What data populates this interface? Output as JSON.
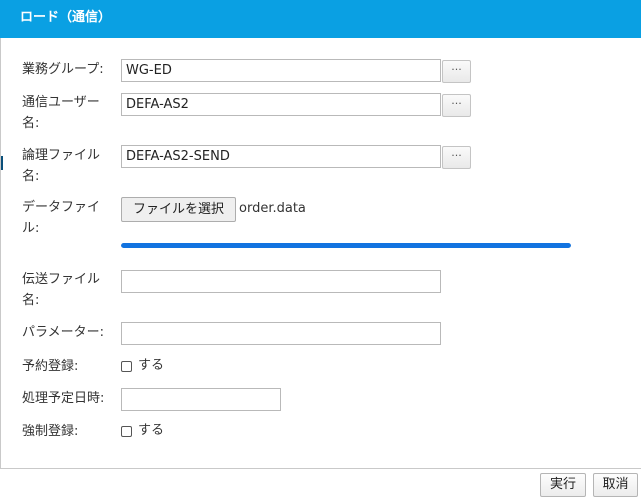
{
  "dialog": {
    "title": "ロード（通信）"
  },
  "form": {
    "business_group": {
      "label": "業務グループ:",
      "value": "WG-ED",
      "browse_label": "···"
    },
    "comm_user": {
      "label_line1": "通信ユーザー",
      "label_line2": "名:",
      "value": "DEFA-AS2",
      "browse_label": "···"
    },
    "logical_file": {
      "label_line1": "論理ファイル",
      "label_line2": "名:",
      "value": "DEFA-AS2-SEND",
      "browse_label": "···"
    },
    "data_file": {
      "label_line1": "データファイ",
      "label_line2": "ル:",
      "choose_label": "ファイルを選択",
      "file_name": "order.data",
      "upload_progress": 1.0
    },
    "transfer_file": {
      "label_line1": "伝送ファイル",
      "label_line2": "名:",
      "value": ""
    },
    "parameter": {
      "label": "パラメーター:",
      "value": ""
    },
    "reservation": {
      "label": "予約登録:",
      "checkbox_label": "する",
      "checked": false
    },
    "scheduled_datetime": {
      "label": "処理予定日時:",
      "value": ""
    },
    "forced": {
      "label": "強制登録:",
      "checkbox_label": "する",
      "checked": false
    }
  },
  "footer": {
    "execute_label": "実行",
    "cancel_label": "取消"
  },
  "colors": {
    "titlebar": "#0aa0e3",
    "progress": "#1273e0"
  }
}
